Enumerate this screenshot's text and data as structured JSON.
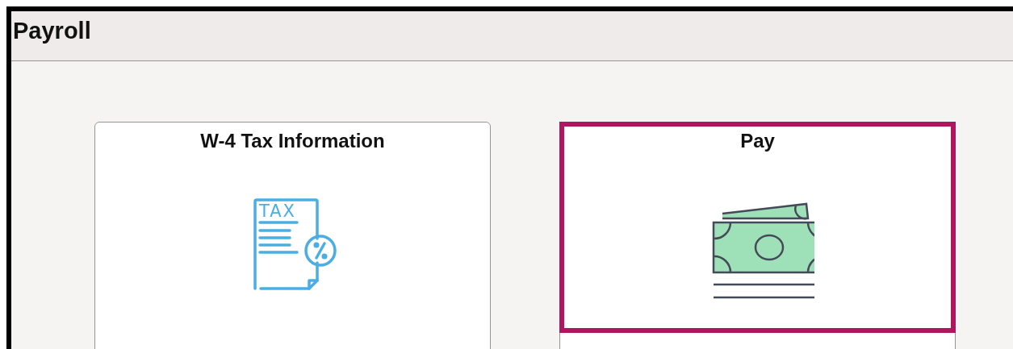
{
  "header": {
    "title": "Payroll"
  },
  "tiles": [
    {
      "title": "W-4 Tax Information",
      "kind": "tax",
      "icon_text": "TAX",
      "selected": false
    },
    {
      "title": "Pay",
      "kind": "money",
      "selected": true
    }
  ]
}
